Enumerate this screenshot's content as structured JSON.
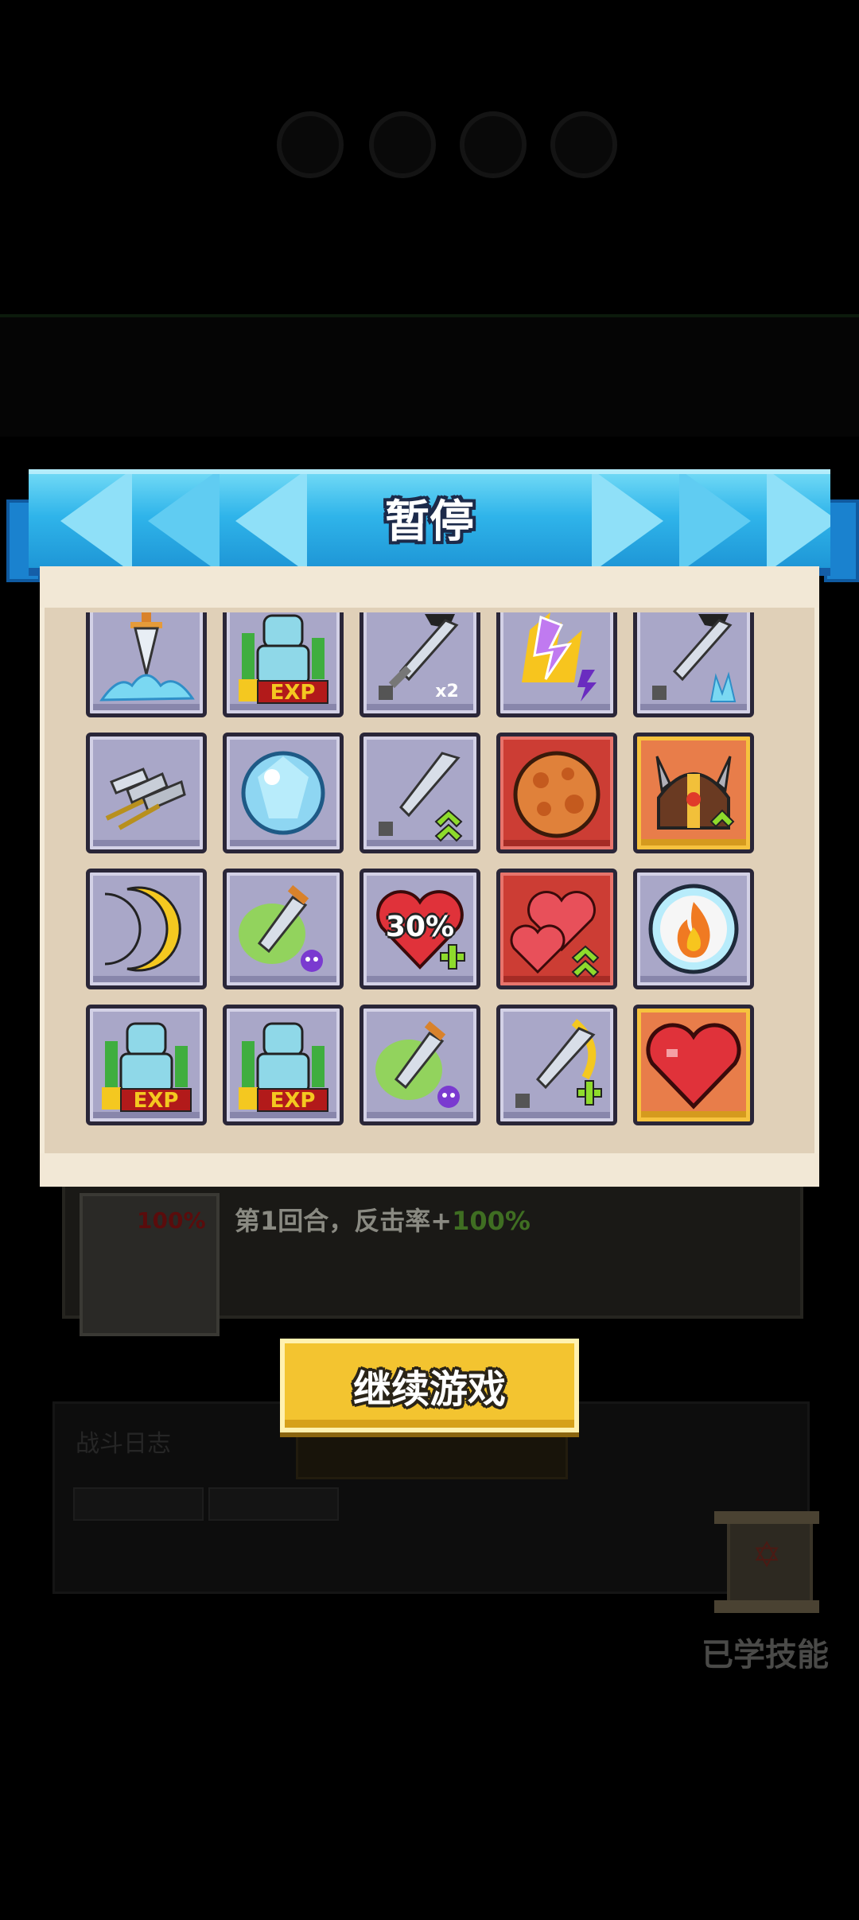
{
  "dialog": {
    "title": "暂停",
    "continue_label": "继续游戏"
  },
  "skills": [
    {
      "icon": "sword-splash-icon",
      "style": "normal"
    },
    {
      "icon": "exp-boost-icon",
      "style": "normal",
      "badge": "EXP"
    },
    {
      "icon": "double-sword-icon",
      "style": "normal",
      "badge": "x2"
    },
    {
      "icon": "lightning-fire-icon",
      "style": "normal"
    },
    {
      "icon": "frost-sword-icon",
      "style": "normal"
    },
    {
      "icon": "triple-sword-icon",
      "style": "normal"
    },
    {
      "icon": "crystal-orb-icon",
      "style": "normal"
    },
    {
      "icon": "sword-upgrade-icon",
      "style": "normal"
    },
    {
      "icon": "magma-orb-icon",
      "style": "red"
    },
    {
      "icon": "viking-helmet-icon",
      "style": "gold"
    },
    {
      "icon": "crescent-moon-icon",
      "style": "normal"
    },
    {
      "icon": "poison-dagger-icon",
      "style": "normal"
    },
    {
      "icon": "heart-heal-icon",
      "style": "normal",
      "badge": "30%"
    },
    {
      "icon": "double-heart-icon",
      "style": "red"
    },
    {
      "icon": "fire-bubble-icon",
      "style": "normal"
    },
    {
      "icon": "exp-boost-icon",
      "style": "normal",
      "badge": "EXP"
    },
    {
      "icon": "exp-boost-icon",
      "style": "normal",
      "badge": "EXP"
    },
    {
      "icon": "poison-dagger-icon",
      "style": "normal"
    },
    {
      "icon": "sword-slash-plus-icon",
      "style": "normal"
    },
    {
      "icon": "heart-icon",
      "style": "gold"
    }
  ],
  "background": {
    "card_icon_text": "100%",
    "card_text_prefix": "第1回合，反击率+",
    "card_text_value": "100%",
    "learned_skills_label": "已学技能",
    "panel_title": "战斗日志"
  }
}
